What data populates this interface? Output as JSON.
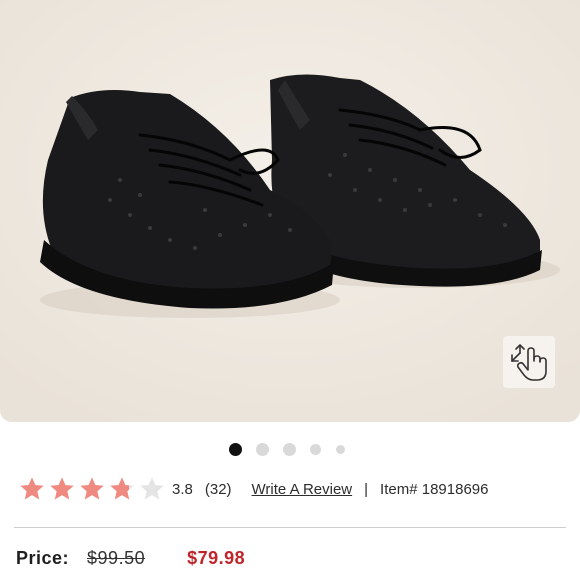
{
  "gallery": {
    "image": "black-rhinestone-sneakers-image",
    "dots_total": 5,
    "active_dot": 1
  },
  "rating": {
    "value": "3.8",
    "stars_max": 5,
    "stars_filled": 3.8,
    "count": "(32)",
    "star_color": "#ef8a80",
    "write_review": "Write A Review",
    "separator": "|",
    "item_number": "Item# 18918696"
  },
  "price": {
    "label": "Price:",
    "original": "$99.50",
    "sale": "$79.98",
    "sale_color": "#c0252c"
  },
  "icons": {
    "zoom": "zoom-expand-hand-icon",
    "star": "star-icon"
  }
}
